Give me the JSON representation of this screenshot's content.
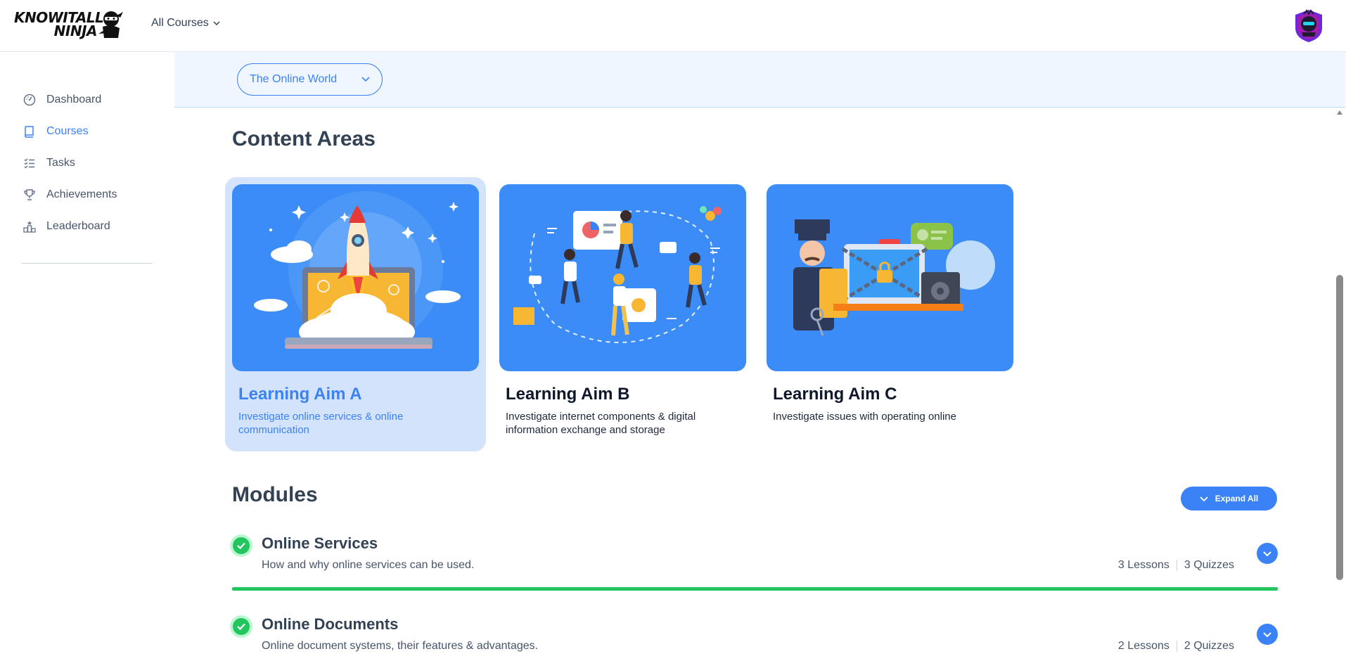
{
  "header": {
    "logo_text_line1": "KNOWITALL",
    "logo_text_line2": "NINJA",
    "all_courses_label": "All Courses"
  },
  "sidebar": {
    "items": [
      {
        "label": "Dashboard",
        "icon": "dashboard-icon",
        "active": false
      },
      {
        "label": "Courses",
        "icon": "book-icon",
        "active": true
      },
      {
        "label": "Tasks",
        "icon": "tasks-icon",
        "active": false
      },
      {
        "label": "Achievements",
        "icon": "trophy-icon",
        "active": false
      },
      {
        "label": "Leaderboard",
        "icon": "leaderboard-icon",
        "active": false
      }
    ]
  },
  "course_selector": {
    "value": "The Online World"
  },
  "content_areas": {
    "heading": "Content Areas",
    "cards": [
      {
        "title": "Learning Aim A",
        "description": "Investigate online services & online communication",
        "selected": true
      },
      {
        "title": "Learning Aim B",
        "description": "Investigate internet components & digital information exchange and storage",
        "selected": false
      },
      {
        "title": "Learning Aim C",
        "description": "Investigate issues with operating online",
        "selected": false
      }
    ]
  },
  "modules": {
    "heading": "Modules",
    "expand_all_label": "Expand All",
    "items": [
      {
        "title": "Online Services",
        "description": "How and why online services can be used.",
        "lessons": "3 Lessons",
        "quizzes": "3 Quizzes",
        "completed": true
      },
      {
        "title": "Online Documents",
        "description": "Online document systems, their features & advantages.",
        "lessons": "2 Lessons",
        "quizzes": "2 Quizzes",
        "completed": true
      }
    ]
  },
  "colors": {
    "accent": "#3b82f6",
    "success": "#22c55e",
    "card_bg": "#3b8cf7",
    "subheader_bg": "#eff6ff"
  }
}
